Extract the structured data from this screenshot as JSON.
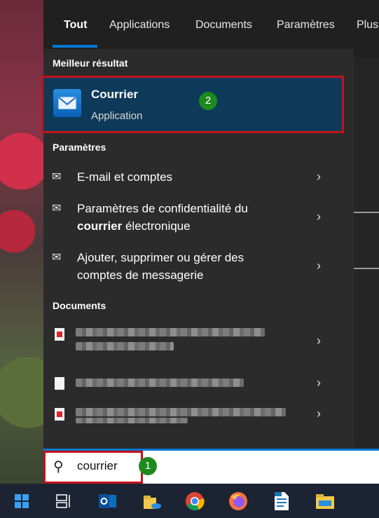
{
  "tabs": [
    {
      "label": "Tout",
      "active": true
    },
    {
      "label": "Applications"
    },
    {
      "label": "Documents"
    },
    {
      "label": "Paramètres"
    },
    {
      "label": "Plus"
    }
  ],
  "sections": {
    "best_match": "Meilleur résultat",
    "settings": "Paramètres",
    "documents": "Documents"
  },
  "best_match": {
    "title": "Courrier",
    "subtitle": "Application",
    "icon": "mail-app-icon",
    "annotation": "2"
  },
  "settings_items": [
    {
      "line1": "E-mail et comptes"
    },
    {
      "line1": "Paramètres de confidentialité du",
      "line2_bold": "courrier",
      "line2_rest": " électronique"
    },
    {
      "line1": "Ajouter, supprimer ou gérer des",
      "line2_rest": "comptes de messagerie"
    }
  ],
  "search": {
    "value": "courrier",
    "icon": "search-icon",
    "annotation": "1"
  },
  "taskbar": [
    "start-icon",
    "task-view-icon",
    "outlook-icon",
    "explorer-folder-icon",
    "chrome-icon",
    "firefox-icon",
    "libreoffice-writer-icon",
    "file-explorer-icon"
  ],
  "colors": {
    "accent": "#0078d4",
    "highlight_border": "#c4121b",
    "badge": "#1e8a1e",
    "best_bg": "#0e3a5a"
  }
}
